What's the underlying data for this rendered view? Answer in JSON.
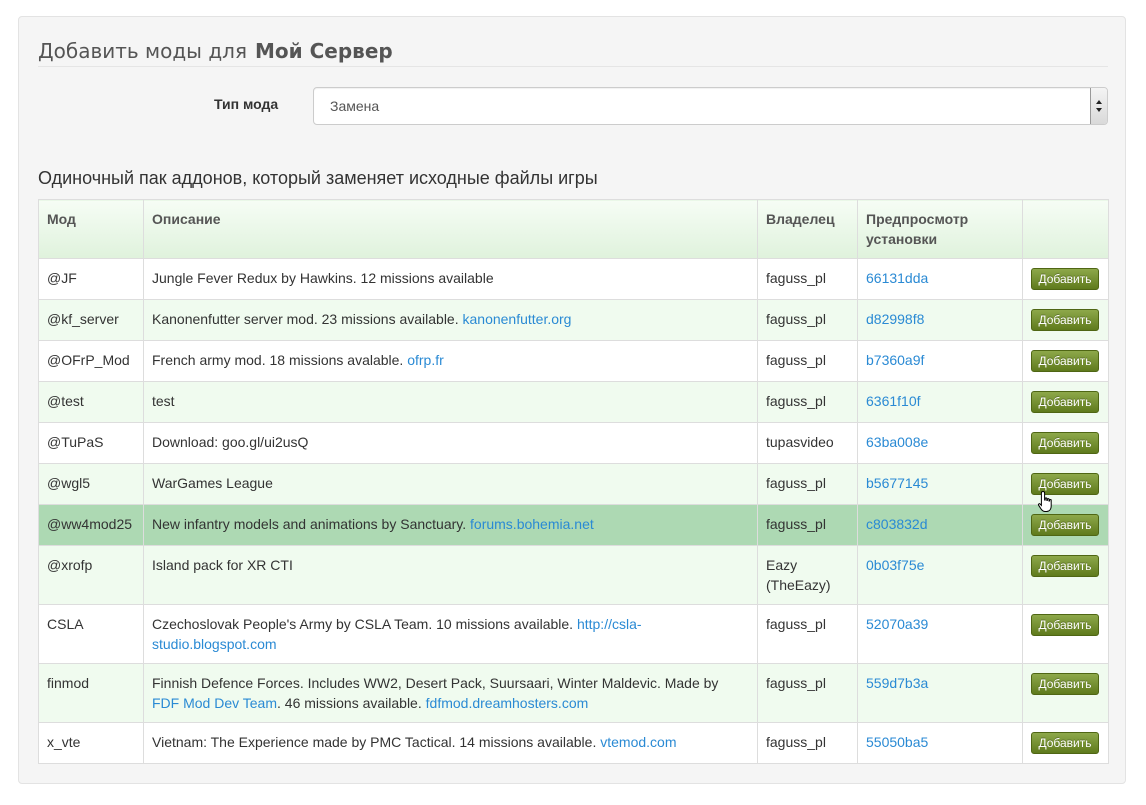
{
  "header": {
    "title_prefix": "Добавить моды для",
    "server_name": "Мой Сервер"
  },
  "form": {
    "mod_type_label": "Тип мода",
    "mod_type_value": "Замена"
  },
  "section": {
    "description": "Одиночный пак аддонов, который заменяет исходные файлы игры"
  },
  "table": {
    "columns": {
      "mod": "Мод",
      "description": "Описание",
      "owner": "Владелец",
      "preview": "Предпросмотр установки",
      "action": ""
    },
    "add_label": "Добавить",
    "rows": [
      {
        "mod": "@JF",
        "desc": "Jungle Fever Redux by Hawkins. 12 missions available",
        "owner": "faguss_pl",
        "preview": "66131dda"
      },
      {
        "mod": "@kf_server",
        "desc": "Kanonenfutter server mod. 23 missions available.",
        "desc_link": "kanonenfutter.org",
        "owner": "faguss_pl",
        "preview": "d82998f8"
      },
      {
        "mod": "@OFrP_Mod",
        "desc": "French army mod. 18 missions avalable.",
        "desc_link": "ofrp.fr",
        "owner": "faguss_pl",
        "preview": "b7360a9f"
      },
      {
        "mod": "@test",
        "desc": "test",
        "owner": "faguss_pl",
        "preview": "6361f10f"
      },
      {
        "mod": "@TuPaS",
        "desc": "Download: goo.gl/ui2usQ",
        "owner": "tupasvideo",
        "preview": "63ba008e"
      },
      {
        "mod": "@wgl5",
        "desc": "WarGames League",
        "owner": "faguss_pl",
        "preview": "b5677145"
      },
      {
        "mod": "@ww4mod25",
        "desc": "New infantry models and animations by Sanctuary.",
        "desc_link": "forums.bohemia.net",
        "owner": "faguss_pl",
        "preview": "c803832d"
      },
      {
        "mod": "@xrofp",
        "desc": "Island pack for XR CTI",
        "owner": "Eazy (TheEazy)",
        "preview": "0b03f75e"
      },
      {
        "mod": "CSLA",
        "desc": "Czechoslovak People's Army by CSLA Team. 10 missions available.",
        "desc_link": "http://csla-studio.blogspot.com",
        "owner": "faguss_pl",
        "preview": "52070a39"
      },
      {
        "mod": "finmod",
        "desc": "Finnish Defence Forces. Includes WW2, Desert Pack, Suursaari, Winter Maldevic. Made by",
        "desc_link": "FDF Mod Dev Team",
        "desc_after": ". 46 missions available.",
        "desc_link2": "fdfmod.dreamhosters.com",
        "owner": "faguss_pl",
        "preview": "559d7b3a"
      },
      {
        "mod": "x_vte",
        "desc": "Vietnam: The Experience made by PMC Tactical. 14 missions available.",
        "desc_link": "vtemod.com",
        "owner": "faguss_pl",
        "preview": "55050ba5"
      }
    ]
  },
  "colors": {
    "link": "#2a8ad4",
    "button": "#6f8a2a",
    "row_alt": "#f0fbef",
    "row_hover": "#add9b3",
    "header": "#dff2dc"
  }
}
